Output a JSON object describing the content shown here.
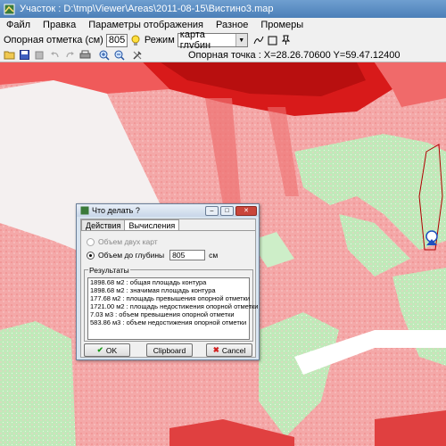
{
  "window": {
    "title": "Участок : D:\\tmp\\Viewer\\Areas\\2011-08-15\\Вистино3.map"
  },
  "menu": [
    "Файл",
    "Правка",
    "Параметры отображения",
    "Разное",
    "Промеры"
  ],
  "options": {
    "ref_label": "Опорная отметка (см)",
    "ref_value": "805",
    "mode_label": "Режим",
    "mode_value": "карта глубин"
  },
  "toolbar": {
    "anchor_label": "Опорная точка : ",
    "anchor_value": "X=28.26.70600 Y=59.47.12400"
  },
  "dialog": {
    "title": "Что делать ?",
    "tabs": [
      "Действия",
      "Вычисления"
    ],
    "active_tab": "Вычисления",
    "option_two_maps": "Объем двух карт",
    "option_depth": "Объем до глубины",
    "depth_value": "805",
    "depth_unit": "см",
    "results_label": "Результаты",
    "results": [
      "1898.68 м2 : общая площадь контура",
      "1898.68 м2 : значимая площадь контура",
      "177.68 м2 : площадь превышения опорной отметки",
      "1721.00 м2 : площадь недостижения опорной отметки",
      "7.03 м3 : объем превышения опорной отметки",
      "583.86 м3 : объем недостижения опорной отметки"
    ],
    "ok_label": "OK",
    "clipboard_label": "Clipboard",
    "cancel_label": "Cancel"
  }
}
